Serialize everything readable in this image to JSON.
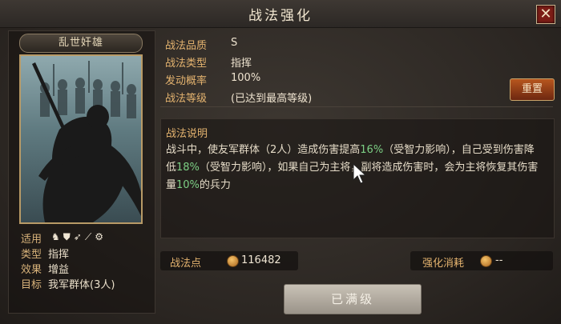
{
  "window": {
    "title": "战法强化",
    "close_icon": "close-icon"
  },
  "card": {
    "name": "乱世奸雄",
    "attributes": [
      {
        "key": "适用",
        "value": ""
      },
      {
        "key": "类型",
        "value": "指挥"
      },
      {
        "key": "效果",
        "value": "增益"
      },
      {
        "key": "目标",
        "value": "我军群体(3人)"
      }
    ],
    "troop_icons": [
      "cavalry-icon",
      "shield-icon",
      "archer-icon",
      "spear-icon",
      "siege-icon"
    ]
  },
  "info": [
    {
      "key": "战法品质",
      "value": "S"
    },
    {
      "key": "战法类型",
      "value": "指挥"
    },
    {
      "key": "发动概率",
      "value": "100%"
    },
    {
      "key": "战法等级",
      "value": "(已达到最高等级)"
    }
  ],
  "reset_label": "重置",
  "description": {
    "title": "战法说明",
    "seg1": "战斗中，使友军群体（2人）造成伤害提高",
    "pct1": "16%",
    "seg2": "（受智力影响），自己受到伤害降低",
    "pct2": "18%",
    "seg3": "（受智力影响），如果自己为主将，副将造成伤害时，会为主将恢复其伤害量",
    "pct3": "10%",
    "seg4": "的兵力"
  },
  "stats": {
    "points_label": "战法点",
    "points_value": "116482",
    "cost_label": "强化消耗",
    "cost_value": "--"
  },
  "max_button": "已满级",
  "colors": {
    "accent": "#e4b36f",
    "highlight": "#7ccf84",
    "reset": "#b7561e"
  }
}
